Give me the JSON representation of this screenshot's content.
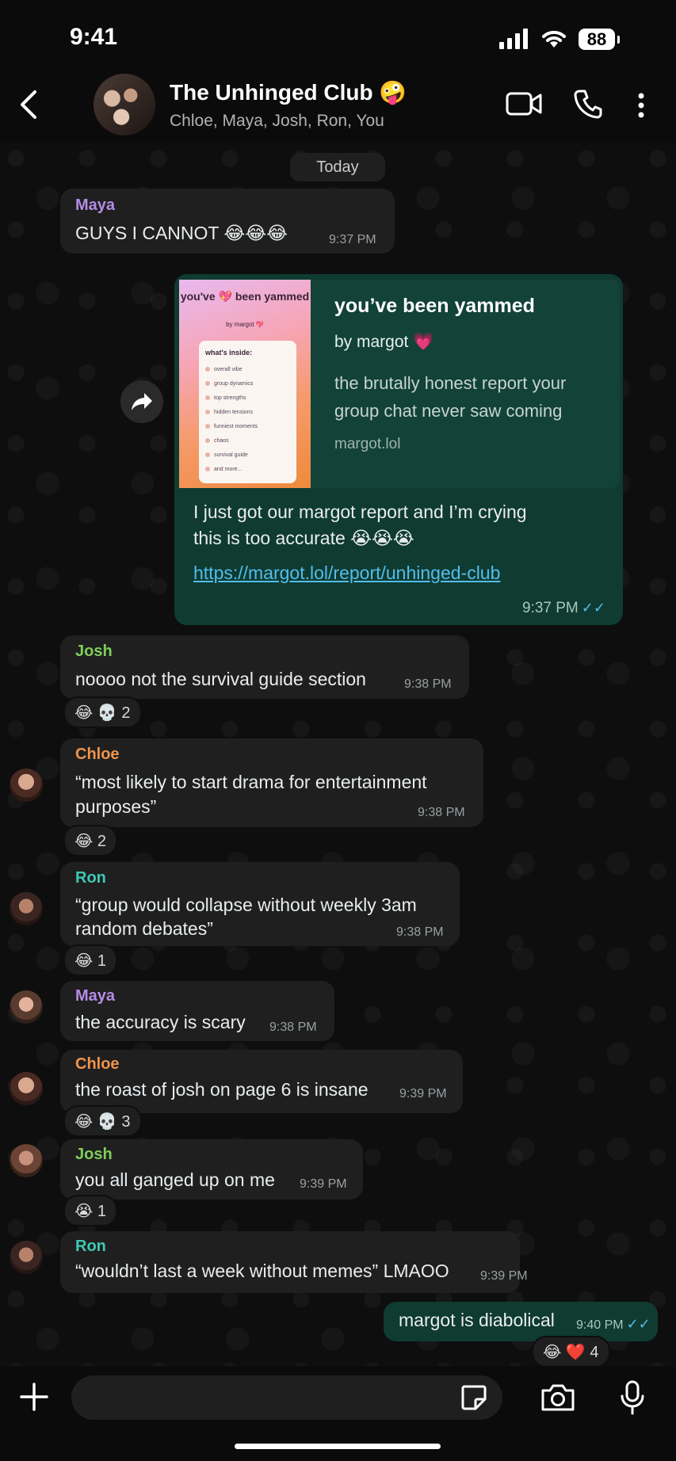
{
  "status_bar": {
    "time": "9:41",
    "battery": "88"
  },
  "header": {
    "title": "The Unhinged Club 🤪",
    "members": "Chloe, Maya, Josh, Ron, You"
  },
  "date_divider": "Today",
  "colors": {
    "maya": "#b48ce6",
    "josh": "#7fce5a",
    "chloe": "#f0934a",
    "ron": "#3ec8b4",
    "outgoing": "#0f3b31",
    "incoming": "#1f1f1f",
    "link": "#53bdeb"
  },
  "messages": [
    {
      "sender": "Maya",
      "text": "GUYS I CANNOT 😂😂😂",
      "time": "9:37 PM"
    },
    {
      "sender": "You",
      "preview": {
        "thumb_title": "you've 💖 been yammed",
        "thumb_by": "by margot 💖",
        "thumb_heading": "what's inside:",
        "thumb_items": [
          "overall vibe",
          "group dynamics",
          "top strengths",
          "hidden tensions",
          "funniest moments",
          "chaos",
          "survival guide",
          "and more..."
        ],
        "title": "you’ve been yammed",
        "by": "by margot 💗",
        "description": "the brutally honest report your group chat never saw coming",
        "domain": "margot.lol"
      },
      "text_line1": "I just got our margot report and I’m crying",
      "text_line2": "this is too accurate 😭😭😭",
      "link": "https://margot.lol/report/unhinged-club",
      "time": "9:37 PM"
    },
    {
      "sender": "Josh",
      "text": "noooo not the survival guide section",
      "time": "9:38 PM",
      "reactions": "😂 💀 2"
    },
    {
      "sender": "Chloe",
      "line1": "“most likely to start drama for entertainment",
      "line2": "purposes”",
      "time": "9:38 PM",
      "reactions": "😂 2"
    },
    {
      "sender": "Ron",
      "line1": "“group would collapse without weekly 3am",
      "line2": "random debates”",
      "time": "9:38 PM",
      "reactions": "😂 1"
    },
    {
      "sender": "Maya",
      "text": "the accuracy is scary",
      "time": "9:38 PM"
    },
    {
      "sender": "Chloe",
      "text": "the roast of josh on page 6 is insane",
      "time": "9:39 PM",
      "reactions": "😂 💀 3"
    },
    {
      "sender": "Josh",
      "text": "you all ganged up on me",
      "time": "9:39 PM",
      "reactions": "😭 1"
    },
    {
      "sender": "Ron",
      "text": "“wouldn’t last a week without memes” LMAOO",
      "time": "9:39 PM"
    },
    {
      "sender": "You",
      "text": "margot is diabolical",
      "time": "9:40 PM",
      "reactions": "😂 ❤️ 4"
    }
  ],
  "composer": {
    "placeholder": ""
  }
}
